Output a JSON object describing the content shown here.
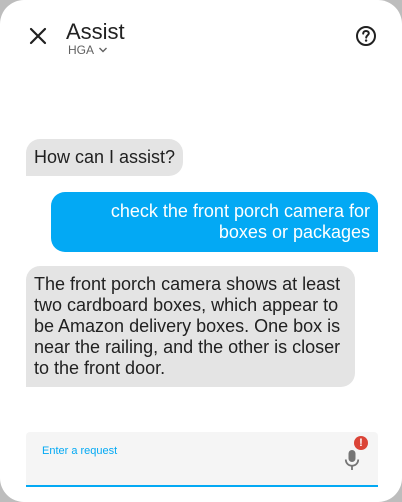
{
  "header": {
    "title": "Assist",
    "pipeline": "HGA",
    "close_icon": "close-icon",
    "help_icon": "help-circle-icon",
    "pipeline_icon": "chevron-down-icon"
  },
  "conversation": [
    {
      "from": "hass",
      "text": "How can I assist?"
    },
    {
      "from": "user",
      "text": "check the front porch camera for boxes or packages"
    },
    {
      "from": "hass",
      "text": "The front porch camera shows at least two cardboard boxes, which appear to be Amazon delivery boxes. One box is near the railing, and the other is closer to the front door."
    }
  ],
  "input": {
    "label": "Enter a request",
    "value": "",
    "mic_icon": "microphone-icon",
    "badge_text": "!"
  },
  "colors": {
    "accent": "#03a9f4",
    "hass_bubble": "#e4e4e4",
    "error_badge": "#db4437"
  }
}
